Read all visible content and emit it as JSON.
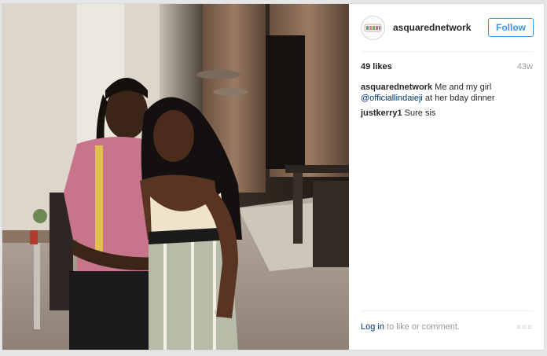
{
  "post": {
    "username": "asquarednetwork",
    "follow_label": "Follow",
    "likes": "49 likes",
    "age": "43w",
    "comments": [
      {
        "user": "asquarednetwork",
        "text_before": "Me and my girl",
        "mention": "@officiallindaieji",
        "text_after": "at her bday dinner"
      },
      {
        "user": "justkerry1",
        "text_before": "Sure sis",
        "mention": "",
        "text_after": ""
      }
    ],
    "login_label": "Log in",
    "login_suffix": "to like or comment.",
    "more_icon": "more-options-icon"
  },
  "colors": {
    "accent": "#3897f0",
    "link": "#003569",
    "muted": "#999999"
  }
}
